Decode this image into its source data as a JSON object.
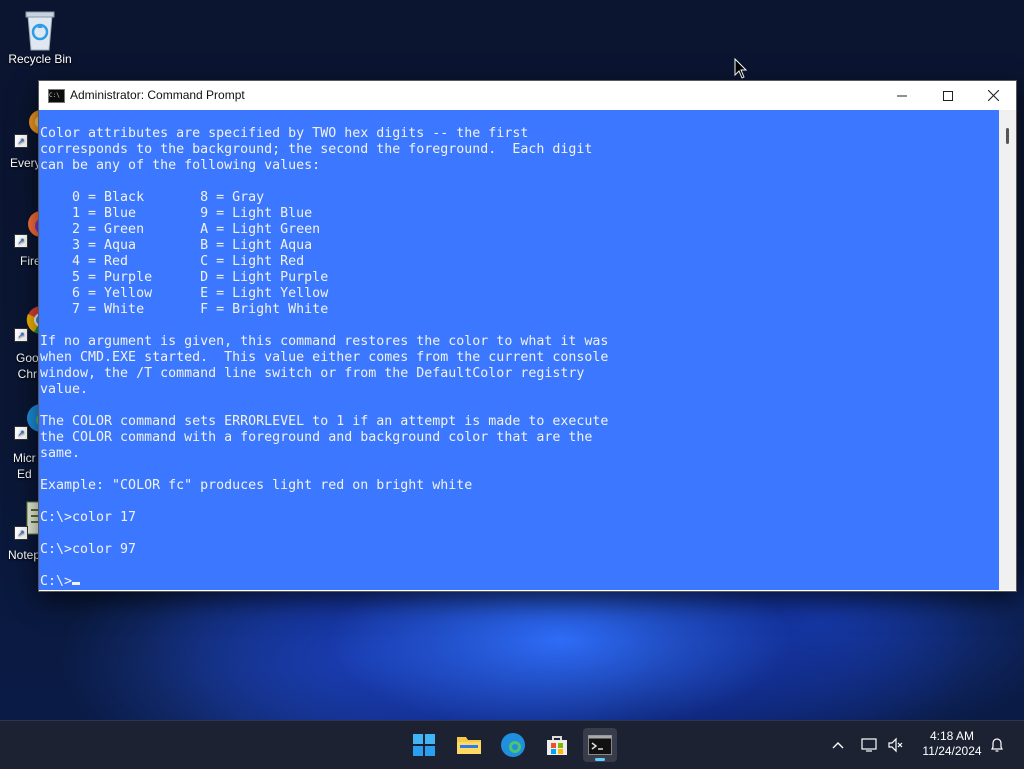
{
  "desktop": {
    "icons": [
      {
        "label": "Recycle Bin",
        "icon": "recycle-bin-icon"
      },
      {
        "label": "Every",
        "icon": "everything-icon"
      },
      {
        "label": "Fire",
        "icon": "firefox-icon"
      },
      {
        "label": "Goo\nChr",
        "icon": "chrome-icon"
      },
      {
        "label": "Micr\nEd",
        "icon": "edge-icon"
      },
      {
        "label": "Notep",
        "icon": "notepad-icon"
      }
    ]
  },
  "window": {
    "title": "Administrator: Command Prompt",
    "console_bg": "#3b78ff",
    "console_fg": "#f2f2f2",
    "lines": [
      "Color attributes are specified by TWO hex digits -- the first",
      "corresponds to the background; the second the foreground.  Each digit",
      "can be any of the following values:",
      "",
      "    0 = Black       8 = Gray",
      "    1 = Blue        9 = Light Blue",
      "    2 = Green       A = Light Green",
      "    3 = Aqua        B = Light Aqua",
      "    4 = Red         C = Light Red",
      "    5 = Purple      D = Light Purple",
      "    6 = Yellow      E = Light Yellow",
      "    7 = White       F = Bright White",
      "",
      "If no argument is given, this command restores the color to what it was",
      "when CMD.EXE started.  This value either comes from the current console",
      "window, the /T command line switch or from the DefaultColor registry",
      "value.",
      "",
      "The COLOR command sets ERRORLEVEL to 1 if an attempt is made to execute",
      "the COLOR command with a foreground and background color that are the",
      "same.",
      "",
      "Example: \"COLOR fc\" produces light red on bright white",
      "",
      "C:\\>color 17",
      "",
      "C:\\>color 97",
      "",
      "C:\\>"
    ]
  },
  "taskbar": {
    "apps": [
      {
        "name": "start-button",
        "icon": "windows-logo-icon",
        "active": false
      },
      {
        "name": "file-explorer",
        "icon": "folder-icon",
        "active": false
      },
      {
        "name": "edge",
        "icon": "edge-icon",
        "active": false
      },
      {
        "name": "microsoft-store",
        "icon": "store-icon",
        "active": false
      },
      {
        "name": "command-prompt",
        "icon": "terminal-icon",
        "active": true
      }
    ],
    "clock": {
      "time": "4:18 AM",
      "date": "11/24/2024"
    }
  }
}
